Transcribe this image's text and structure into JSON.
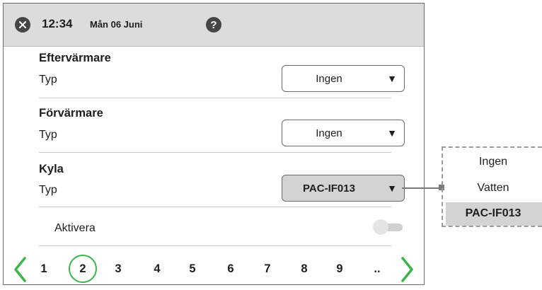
{
  "header": {
    "time": "12:34",
    "date": "Mån 06 Juni",
    "close_icon": "close-icon",
    "help_icon": "help-icon"
  },
  "sections": [
    {
      "title": "Eftervärmare",
      "label": "Typ",
      "value": "Ingen"
    },
    {
      "title": "Förvärmare",
      "label": "Typ",
      "value": "Ingen"
    },
    {
      "title": "Kyla",
      "label": "Typ",
      "value": "PAC-IF013"
    }
  ],
  "activate": {
    "label": "Aktivera",
    "enabled": false
  },
  "pagination": {
    "pages": [
      "1",
      "2",
      "3",
      "4",
      "5",
      "6",
      "7",
      "8",
      "9",
      ".."
    ],
    "current": "2"
  },
  "dropdown": {
    "options": [
      "Ingen",
      "Vatten",
      "PAC-IF013"
    ],
    "selected": "PAC-IF013"
  },
  "colors": {
    "accent": "#3cb44a",
    "header_bg": "#dcdcdc",
    "icon_dark": "#454545",
    "selected_bg": "#d3d3d3"
  }
}
